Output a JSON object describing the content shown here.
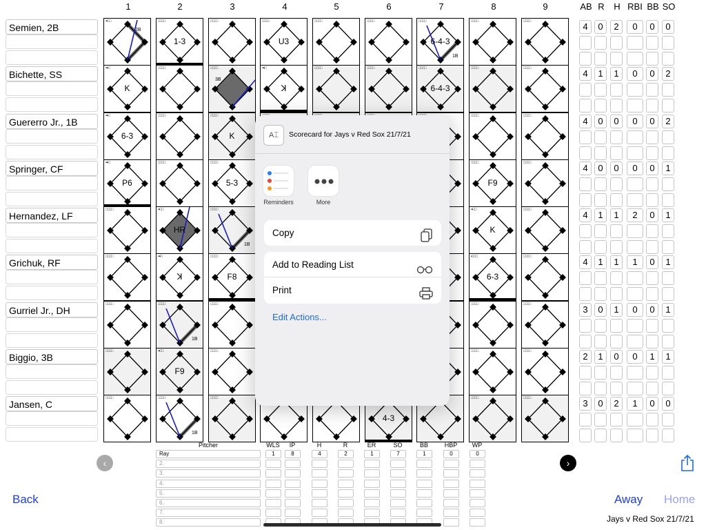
{
  "innings": [
    "1",
    "2",
    "3",
    "4",
    "5",
    "6",
    "7",
    "8",
    "9"
  ],
  "stat_headers": [
    "AB",
    "R",
    "H",
    "RBI",
    "BB",
    "SO"
  ],
  "lineup": [
    {
      "name": "Semien, 2B",
      "stats": [
        "4",
        "0",
        "2",
        "0",
        "0",
        "0"
      ]
    },
    {
      "name": "Bichette, SS",
      "stats": [
        "4",
        "1",
        "1",
        "0",
        "0",
        "2"
      ]
    },
    {
      "name": "Guererro Jr., 1B",
      "stats": [
        "4",
        "0",
        "0",
        "0",
        "0",
        "2"
      ]
    },
    {
      "name": "Springer, CF",
      "stats": [
        "4",
        "0",
        "0",
        "0",
        "0",
        "1"
      ]
    },
    {
      "name": "Hernandez, LF",
      "stats": [
        "4",
        "1",
        "1",
        "2",
        "0",
        "1"
      ]
    },
    {
      "name": "Grichuk, RF",
      "stats": [
        "4",
        "1",
        "1",
        "1",
        "0",
        "1"
      ]
    },
    {
      "name": "Gurriel Jr., DH",
      "stats": [
        "3",
        "0",
        "1",
        "0",
        "0",
        "1"
      ]
    },
    {
      "name": "Biggio, 3B",
      "stats": [
        "2",
        "1",
        "0",
        "0",
        "1",
        "1"
      ]
    },
    {
      "name": "Jansen, C",
      "stats": [
        "3",
        "0",
        "2",
        "1",
        "0",
        "0"
      ]
    }
  ],
  "cells": [
    {
      "r": 0,
      "c": 0,
      "label": "",
      "note": "2B",
      "line": "hit"
    },
    {
      "r": 0,
      "c": 1,
      "label": "1-3"
    },
    {
      "r": 0,
      "c": 3,
      "label": "U3"
    },
    {
      "r": 0,
      "c": 6,
      "label": "6-4-3",
      "note": "1B",
      "line": "single"
    },
    {
      "r": 1,
      "c": 0,
      "label": "K"
    },
    {
      "r": 1,
      "c": 2,
      "label": "",
      "note": "3B",
      "line": "triple"
    },
    {
      "r": 1,
      "c": 3,
      "label": "ꓘ"
    },
    {
      "r": 1,
      "c": 6,
      "label": "6-4-3"
    },
    {
      "r": 2,
      "c": 0,
      "label": "6-3"
    },
    {
      "r": 2,
      "c": 2,
      "label": "K"
    },
    {
      "r": 3,
      "c": 0,
      "label": "P6"
    },
    {
      "r": 3,
      "c": 2,
      "label": "5-3"
    },
    {
      "r": 3,
      "c": 7,
      "label": "F9"
    },
    {
      "r": 4,
      "c": 1,
      "label": "HR",
      "line": "hr"
    },
    {
      "r": 4,
      "c": 2,
      "label": "",
      "note": "1B",
      "line": "bunt"
    },
    {
      "r": 4,
      "c": 7,
      "label": "K"
    },
    {
      "r": 5,
      "c": 1,
      "label": "ꓘ"
    },
    {
      "r": 5,
      "c": 2,
      "label": "F8"
    },
    {
      "r": 5,
      "c": 7,
      "label": "6-3"
    },
    {
      "r": 6,
      "c": 1,
      "label": "",
      "note": "1B",
      "line": "single"
    },
    {
      "r": 7,
      "c": 1,
      "label": "F9"
    },
    {
      "r": 8,
      "c": 1,
      "label": "",
      "note": "1B",
      "line": "single"
    },
    {
      "r": 8,
      "c": 5,
      "label": "4-3"
    }
  ],
  "pitching": {
    "header_pitcher": "Pitcher",
    "headers": [
      "WLS",
      "IP",
      "H",
      "R",
      "ER",
      "SO",
      "BB",
      "HBP",
      "WP"
    ],
    "rows": [
      {
        "name": "Ray",
        "values": [
          "1",
          "8",
          "4",
          "2",
          "1",
          "7",
          "1",
          "0",
          "0"
        ]
      },
      {
        "name": "2.",
        "values": []
      },
      {
        "name": "3.",
        "values": []
      },
      {
        "name": "4.",
        "values": []
      },
      {
        "name": "5.",
        "values": []
      },
      {
        "name": "6.",
        "values": []
      },
      {
        "name": "7.",
        "values": []
      },
      {
        "name": "8.",
        "values": []
      }
    ]
  },
  "nav": {
    "back": "Back",
    "away": "Away",
    "home": "Home",
    "game_label": "Jays v Red Sox 21/7/21"
  },
  "share": {
    "title": "Scorecard for Jays v Red Sox 21/7/21",
    "apps": [
      {
        "label": "Reminders"
      },
      {
        "label": "More"
      }
    ],
    "actions": [
      {
        "label": "Copy",
        "icon": "copy-icon"
      },
      {
        "label": "Add to Reading List",
        "icon": "glasses-icon"
      },
      {
        "label": "Print",
        "icon": "printer-icon"
      }
    ],
    "edit_label": "Edit Actions..."
  },
  "colors": {
    "link": "#1e3fd9",
    "edit": "#1f6ad8",
    "line": "#1a1acc",
    "path": "#666666"
  }
}
